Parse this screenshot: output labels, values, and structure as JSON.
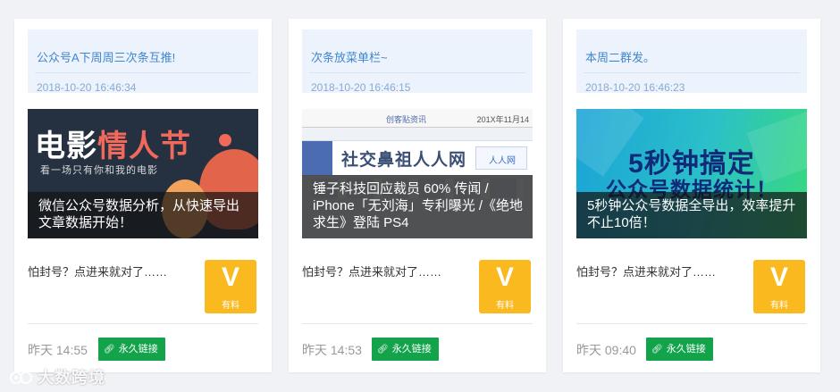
{
  "cards": [
    {
      "note": "公众号A下周周三次条互推!",
      "note_time": "2018-10-20 16:46:34",
      "cover_title": "微信公众号数据分析，从快速导出文章数据开始！",
      "cover_art": {
        "line1_a": "电影",
        "line1_b": "情人节",
        "line2": "看一场只有你和我的电影"
      },
      "excerpt": "怕封号？点进来就对了……",
      "badge_letter": "V",
      "badge_label": "有料",
      "time": "昨天 14:55",
      "link_label": "永久链接"
    },
    {
      "note": "次条放菜单栏~",
      "note_time": "2018-10-20 16:46:15",
      "cover_title": "锤子科技回应裁员 60% 传闻 / iPhone「无刘海」专利曝光 /《绝地求生》登陆 PS4",
      "cover_art": {
        "bar_left": "创客贴资讯",
        "bar_right": "201X年11月14",
        "headline": "社交鼻祖人人网",
        "logo": "人人网"
      },
      "excerpt": "怕封号？点进来就对了……",
      "badge_letter": "V",
      "badge_label": "有料",
      "time": "昨天 14:53",
      "link_label": "永久链接"
    },
    {
      "note": "本周二群发。",
      "note_time": "2018-10-20 16:46:23",
      "cover_title": "5秒钟公众号数据全导出，效率提升不止10倍！",
      "cover_art": {
        "line1": "5秒钟搞定",
        "line2": "公众号数据统计！"
      },
      "excerpt": "怕封号？点进来就对了……",
      "badge_letter": "V",
      "badge_label": "有料",
      "time": "昨天 09:40",
      "link_label": "永久链接"
    }
  ],
  "watermark": "大数跨境",
  "colors": {
    "note_bg": "#edf3fc",
    "note_text": "#3f86d0",
    "badge": "#fbb920",
    "link_button": "#13a34b"
  },
  "icons": {
    "link": "link-icon",
    "badge": "v-badge-icon"
  }
}
